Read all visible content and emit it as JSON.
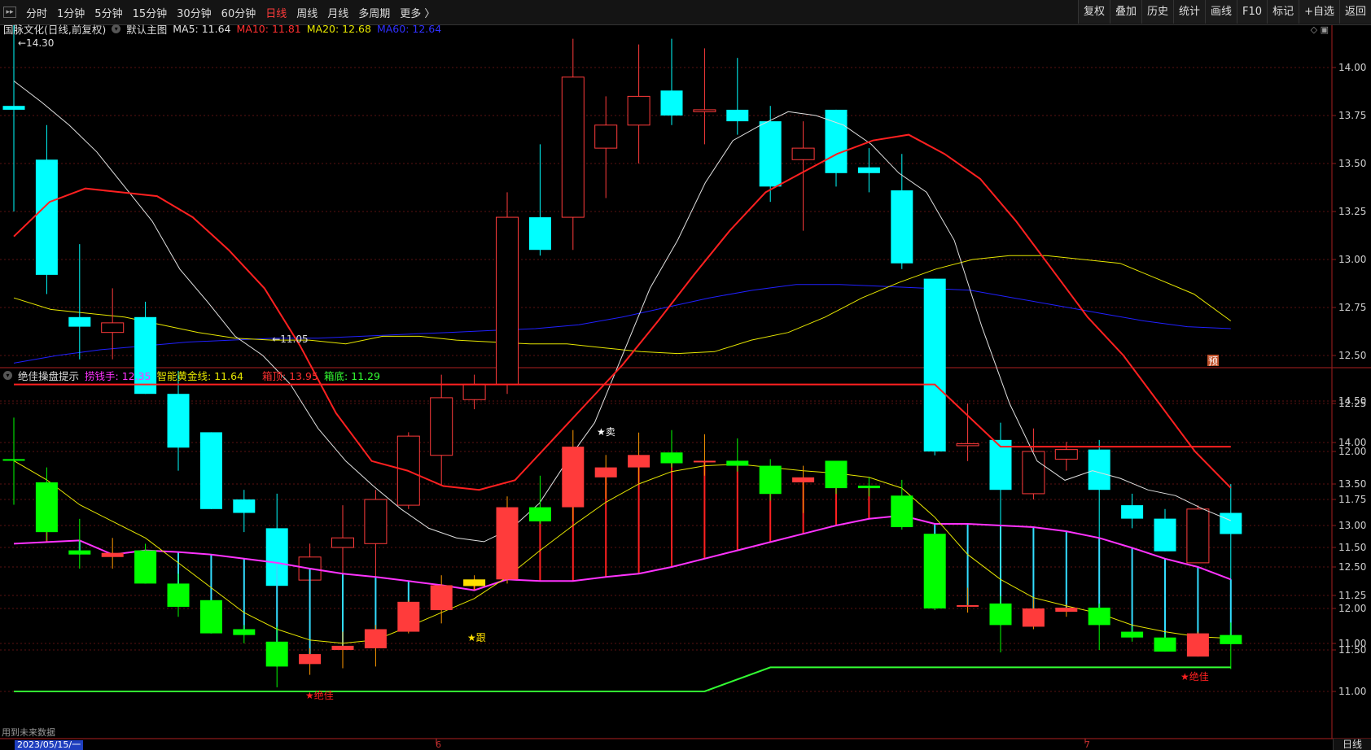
{
  "toolbar": {
    "periods": [
      "分时",
      "1分钟",
      "5分钟",
      "15分钟",
      "30分钟",
      "60分钟",
      "日线",
      "周线",
      "月线",
      "多周期",
      "更多 〉"
    ],
    "active_period": "日线",
    "right_buttons": [
      "复权",
      "叠加",
      "历史",
      "统计",
      "画线",
      "F10",
      "标记",
      "+自选",
      "返回"
    ]
  },
  "main_panel": {
    "stock_label": "国脉文化(日线,前复权)",
    "template_label": "默认主图",
    "ma5": "MA5: 11.64",
    "ma10": "MA10: 11.81",
    "ma20": "MA20: 12.68",
    "ma60": "MA60: 12.64",
    "high_label": "14.30",
    "low_label": "11.05",
    "pre_badge": "预",
    "y_ticks": [
      "14.00",
      "13.75",
      "13.50",
      "13.25",
      "13.00",
      "12.75",
      "12.50",
      "12.25",
      "12.00",
      "11.75",
      "11.50",
      "11.25",
      "11.00"
    ]
  },
  "sub_panel": {
    "indicator_name": "绝佳操盘提示",
    "lao": "捞钱手: 12.35",
    "gold": "智能黄金线: 11.64",
    "top": "箱顶: 13.95",
    "bottom": "箱底: 11.29",
    "signal_sell": "★卖",
    "signal_follow": "★跟",
    "signal_best1": "★绝佳",
    "signal_best2": "★绝佳",
    "y_ticks": [
      "14.50",
      "14.00",
      "13.50",
      "13.00",
      "12.50",
      "12.00",
      "11.50",
      "11.00"
    ]
  },
  "footer": {
    "future_note": "用到未来数据",
    "date": "2023/05/15/一",
    "month_6": "6",
    "month_7": "7",
    "period_tag": "日线"
  },
  "colors": {
    "up": "#ff3b3b",
    "down_main": "#00ffff",
    "down_sub": "#00ff00",
    "ma5": "#e0e0e0",
    "ma10": "#ff2020",
    "ma20": "#e6e600",
    "ma60": "#2020ff",
    "magenta": "#ff33ff",
    "box_top": "#ff2020",
    "box_bottom": "#33ff33"
  },
  "chart_data": {
    "type": "candlestick",
    "candles": [
      {
        "o": 13.8,
        "h": 14.3,
        "l": 13.25,
        "c": 13.78
      },
      {
        "o": 13.52,
        "h": 13.7,
        "l": 12.82,
        "c": 12.92
      },
      {
        "o": 12.7,
        "h": 13.08,
        "l": 12.48,
        "c": 12.65
      },
      {
        "o": 12.62,
        "h": 12.85,
        "l": 12.48,
        "c": 12.67
      },
      {
        "o": 12.7,
        "h": 12.78,
        "l": 12.3,
        "c": 12.3
      },
      {
        "o": 12.3,
        "h": 12.42,
        "l": 11.9,
        "c": 12.02
      },
      {
        "o": 12.1,
        "h": 12.1,
        "l": 11.7,
        "c": 11.7
      },
      {
        "o": 11.75,
        "h": 11.8,
        "l": 11.58,
        "c": 11.68
      },
      {
        "o": 11.6,
        "h": 11.78,
        "l": 11.05,
        "c": 11.3
      },
      {
        "o": 11.33,
        "h": 11.52,
        "l": 11.2,
        "c": 11.45
      },
      {
        "o": 11.5,
        "h": 11.72,
        "l": 11.28,
        "c": 11.55
      },
      {
        "o": 11.52,
        "h": 11.8,
        "l": 11.3,
        "c": 11.75
      },
      {
        "o": 11.72,
        "h": 12.1,
        "l": 11.7,
        "c": 12.08
      },
      {
        "o": 11.98,
        "h": 12.4,
        "l": 11.82,
        "c": 12.28
      },
      {
        "o": 12.27,
        "h": 12.4,
        "l": 12.22,
        "c": 12.35
      },
      {
        "o": 12.35,
        "h": 13.35,
        "l": 12.3,
        "c": 13.22
      },
      {
        "o": 13.22,
        "h": 13.6,
        "l": 13.02,
        "c": 13.05
      },
      {
        "o": 13.22,
        "h": 14.15,
        "l": 13.05,
        "c": 13.95
      },
      {
        "o": 13.58,
        "h": 13.85,
        "l": 13.32,
        "c": 13.7
      },
      {
        "o": 13.7,
        "h": 14.12,
        "l": 13.5,
        "c": 13.85
      },
      {
        "o": 13.88,
        "h": 14.15,
        "l": 13.7,
        "c": 13.75
      },
      {
        "o": 13.77,
        "h": 14.1,
        "l": 13.6,
        "c": 13.78
      },
      {
        "o": 13.78,
        "h": 14.05,
        "l": 13.65,
        "c": 13.72
      },
      {
        "o": 13.72,
        "h": 13.8,
        "l": 13.3,
        "c": 13.38
      },
      {
        "o": 13.52,
        "h": 13.72,
        "l": 13.15,
        "c": 13.58
      },
      {
        "o": 13.78,
        "h": 13.78,
        "l": 13.38,
        "c": 13.45
      },
      {
        "o": 13.48,
        "h": 13.58,
        "l": 13.35,
        "c": 13.45
      },
      {
        "o": 13.36,
        "h": 13.55,
        "l": 12.95,
        "c": 12.98
      },
      {
        "o": 12.9,
        "h": 12.9,
        "l": 11.98,
        "c": 12.0
      },
      {
        "o": 12.03,
        "h": 12.25,
        "l": 11.95,
        "c": 12.04
      },
      {
        "o": 12.06,
        "h": 12.15,
        "l": 11.47,
        "c": 11.8
      },
      {
        "o": 11.78,
        "h": 12.12,
        "l": 11.75,
        "c": 12.0
      },
      {
        "o": 11.96,
        "h": 12.05,
        "l": 11.9,
        "c": 12.01
      },
      {
        "o": 12.01,
        "h": 12.06,
        "l": 11.5,
        "c": 11.8
      },
      {
        "o": 11.72,
        "h": 11.78,
        "l": 11.6,
        "c": 11.65
      },
      {
        "o": 11.65,
        "h": 11.7,
        "l": 11.48,
        "c": 11.48
      },
      {
        "o": 11.42,
        "h": 11.72,
        "l": 11.42,
        "c": 11.7
      },
      {
        "o": 11.68,
        "h": 11.83,
        "l": 11.27,
        "c": 11.57
      }
    ],
    "ma5": [
      13.93,
      13.82,
      13.7,
      13.56,
      13.38,
      13.2,
      12.95,
      12.78,
      12.6,
      12.5,
      12.35,
      12.12,
      11.95,
      11.82,
      11.7,
      11.6,
      11.55,
      11.53,
      11.6,
      11.73,
      11.95,
      12.15,
      12.5,
      12.85,
      13.1,
      13.4,
      13.62,
      13.7,
      13.77,
      13.75,
      13.7,
      13.6,
      13.45,
      13.35,
      13.1,
      12.65,
      12.25,
      11.95,
      11.85,
      11.9,
      11.86,
      11.8,
      11.77,
      11.7,
      11.64
    ],
    "ma10": [
      13.12,
      13.3,
      13.37,
      13.35,
      13.33,
      13.22,
      13.05,
      12.85,
      12.55,
      12.2,
      11.95,
      11.9,
      11.82,
      11.8,
      11.85,
      12.05,
      12.25,
      12.45,
      12.68,
      12.92,
      13.15,
      13.35,
      13.45,
      13.55,
      13.62,
      13.65,
      13.55,
      13.42,
      13.2,
      12.95,
      12.7,
      12.5,
      12.25,
      12.0,
      11.81
    ],
    "ma20": [
      12.8,
      12.74,
      12.72,
      12.7,
      12.66,
      12.62,
      12.59,
      12.58,
      12.58,
      12.56,
      12.6,
      12.6,
      12.58,
      12.57,
      12.56,
      12.56,
      12.54,
      12.52,
      12.51,
      12.52,
      12.58,
      12.62,
      12.7,
      12.8,
      12.88,
      12.95,
      13.0,
      13.02,
      13.02,
      13.0,
      12.98,
      12.9,
      12.82,
      12.68
    ],
    "ma60": [
      12.46,
      12.5,
      12.53,
      12.55,
      12.57,
      12.58,
      12.59,
      12.59,
      12.6,
      12.61,
      12.62,
      12.63,
      12.64,
      12.66,
      12.7,
      12.75,
      12.8,
      12.84,
      12.87,
      12.87,
      12.86,
      12.85,
      12.84,
      12.8,
      12.76,
      12.72,
      12.68,
      12.65,
      12.64
    ],
    "box_top": 13.95,
    "box_bottom": 11.29,
    "lao_qian_shou": 12.35,
    "zhi_neng_huang_jin_xian": 11.64
  }
}
